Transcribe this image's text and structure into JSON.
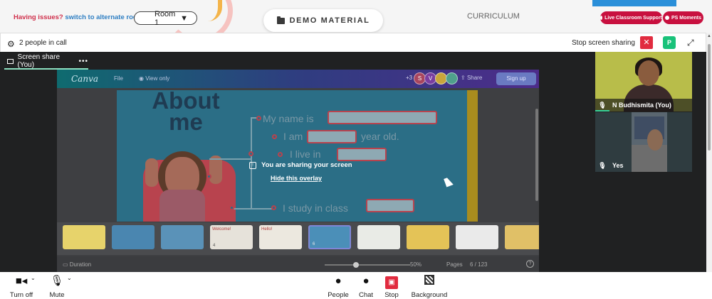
{
  "topbar": {
    "issues_text": "Having issues?",
    "switch_link": "switch to alternate room",
    "room_value": "Room 1",
    "demo_label": "DEMO MATERIAL",
    "curriculum_label": "CURRICULUM",
    "live_support_label": "Live Classroom Support",
    "ps_moments_label": "PS Moments"
  },
  "callbar": {
    "people_count": "2 people in call",
    "stop_sharing_label": "Stop screen sharing",
    "avatar_letter": "P"
  },
  "share_tab": {
    "label": "Screen share (You)",
    "more": "•••"
  },
  "canva": {
    "logo": "Canva",
    "file": "File",
    "view_only": "View only",
    "avatars": [
      "+3",
      "S",
      "V",
      "",
      ""
    ],
    "share": "Share",
    "sign_up": "Sign up"
  },
  "slide": {
    "title_line1": "About",
    "title_line2": "me",
    "line_name": "My name is",
    "line_age_a": "I am",
    "line_age_b": "year old.",
    "line_live": "I live in",
    "line_study": "I study in class"
  },
  "overlay": {
    "message": "You are sharing your screen",
    "hide_link": "Hide this overlay"
  },
  "thumbnails": [
    {
      "title": "",
      "count": ""
    },
    {
      "title": "",
      "count": ""
    },
    {
      "title": "",
      "count": ""
    },
    {
      "title": "Welcome!",
      "count": "4"
    },
    {
      "title": "Hello!",
      "count": ""
    },
    {
      "title": "",
      "count": "6"
    },
    {
      "title": "",
      "count": ""
    },
    {
      "title": "",
      "count": ""
    },
    {
      "title": "",
      "count": ""
    },
    {
      "title": "",
      "count": ""
    }
  ],
  "canva_footer": {
    "duration": "Duration",
    "zoom": "50%",
    "pages": "Pages",
    "page_counter": "6 / 123",
    "help": "?"
  },
  "participants": [
    {
      "name": "N Budhismita (You)"
    },
    {
      "name": "Yes"
    }
  ],
  "controls": {
    "turn_off": "Turn off",
    "mute": "Mute",
    "people": "People",
    "chat": "Chat",
    "stop": "Stop",
    "background": "Background"
  },
  "colors": {
    "accent_red": "#c8103f",
    "link_blue": "#2f7fc3",
    "stop_red": "#e12b3f",
    "avatar_green": "#19c27a"
  }
}
